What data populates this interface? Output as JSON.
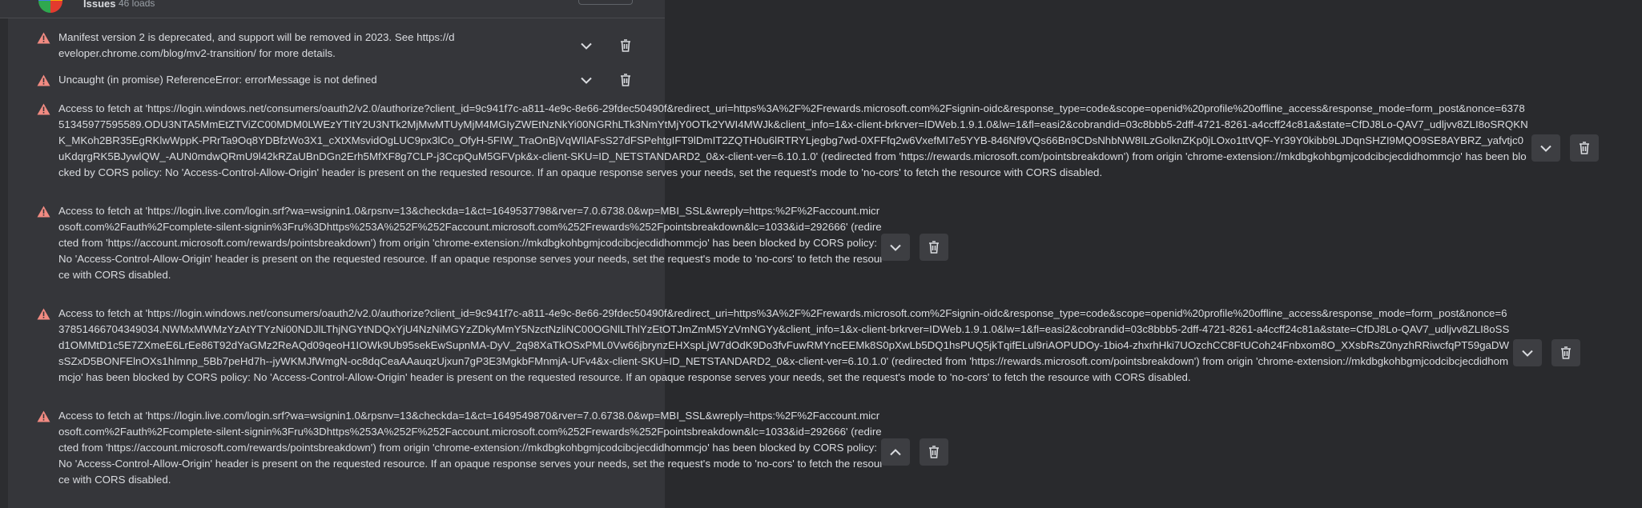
{
  "extension": {
    "name": "Issues",
    "sub": "46 loads"
  },
  "errors": [
    {
      "message": "Manifest version 2 is deprecated, and support will be removed in 2023. See https://developer.chrome.com/blog/mv2-transition/ for more details.",
      "expanded": false
    },
    {
      "message": "Uncaught (in promise) ReferenceError: errorMessage is not defined",
      "expanded": false
    },
    {
      "message": "Access to fetch at 'https://login.windows.net/consumers/oauth2/v2.0/authorize?client_id=9c941f7c-a811-4e9c-8e66-29fdec50490f&redirect_uri=https%3A%2F%2Frewards.microsoft.com%2Fsignin-oidc&response_type=code&scope=openid%20profile%20offline_access&response_mode=form_post&nonce=637851345977595589.ODU3NTA5MmEtZTViZC00MDM0LWEzYTItY2U3NTk2MjMwMTUyMjM4MGIyZWEtNzNkYi00NGRhLTk3NmYtMjY0OTk2YWI4MWJk&client_info=1&x-client-brkrver=IDWeb.1.9.1.0&lw=1&fl=easi2&cobrandid=03c8bbb5-2dff-4721-8261-a4ccff24c81a&state=CfDJ8Lo-QAV7_udljvv8ZLI8oSRQKNK_MKoh2BR35EgRKlwWppK-PRrTa9Oq8YDBfzWo3X1_cXtXMsvidOgLUC9px3lCo_OfyH-5FIW_TraOnBjVqWIlAFsS27dFSPehtgIFT9lDmIT2ZQTH0u6lRTRYLjegbg7wd-0XFFfq2w6VxefMI7e5YYB-846Nf9VQs66Bn9CDsNhbNW8ILzGolknZKp0jLOxo1ttVQF-Yr39Y0kibb9LJDqnSHZI9MQO9SE8AYBRZ_yafvtjc0uKdqrgRK5BJywlQW_-AUN0mdwQRmU9l42kRZaUBnDGn2Erh5MfXF8g7CLP-j3CcpQuM5GFVpk&x-client-SKU=ID_NETSTANDARD2_0&x-client-ver=6.10.1.0' (redirected from 'https://rewards.microsoft.com/pointsbreakdown') from origin 'chrome-extension://mkdbgkohbgmjcodcibcjecdidhommcjo' has been blocked by CORS policy: No 'Access-Control-Allow-Origin' header is present on the requested resource. If an opaque response serves your needs, set the request's mode to 'no-cors' to fetch the resource with CORS disabled.",
      "expanded": false
    },
    {
      "message": "Access to fetch at 'https://login.live.com/login.srf?wa=wsignin1.0&rpsnv=13&checkda=1&ct=1649537798&rver=7.0.6738.0&wp=MBI_SSL&wreply=https:%2F%2Faccount.microsoft.com%2Fauth%2Fcomplete-silent-signin%3Fru%3Dhttps%253A%252F%252Faccount.microsoft.com%252Frewards%252Fpointsbreakdown&lc=1033&id=292666' (redirected from 'https://account.microsoft.com/rewards/pointsbreakdown') from origin 'chrome-extension://mkdbgkohbgmjcodcibcjecdidhommcjo' has been blocked by CORS policy: No 'Access-Control-Allow-Origin' header is present on the requested resource. If an opaque response serves your needs, set the request's mode to 'no-cors' to fetch the resource with CORS disabled.",
      "expanded": false
    },
    {
      "message": "Access to fetch at 'https://login.windows.net/consumers/oauth2/v2.0/authorize?client_id=9c941f7c-a811-4e9c-8e66-29fdec50490f&redirect_uri=https%3A%2F%2Frewards.microsoft.com%2Fsignin-oidc&response_type=code&scope=openid%20profile%20offline_access&response_mode=form_post&nonce=637851466704349034.NWMxMWMzYzAtYTYzNi00NDJlLThjNGYtNDQxYjU4NzNiMGYzZDkyMmY5NzctNzliNC00OGNlLThlYzEtOTJmZmM5YzVmNGYy&client_info=1&x-client-brkrver=IDWeb.1.9.1.0&lw=1&fl=easi2&cobrandid=03c8bbb5-2dff-4721-8261-a4ccff24c81a&state=CfDJ8Lo-QAV7_udljvv8ZLI8oSSd1OMMtD1c5E7ZXmeE6LrEe86T92dYaGMz2ReAQd09qeoH1IOWk9Ub95sekEwSupnMA-DyV_2q98XaTkOSxPML0Vw66jbrynzEHXspLjW7dOdK9Do3fvFuwRMYncEEMk8S0pXwLb5DQ1hsPUQ5jkTqifELul9riAOPUDOy-1bio4-zhxrhHki7UOzchCC8FtUCoh24Fnbxom8O_XXsbRsZ0nyzhRRiwcfqPT59gaDWsSZxD5BONFElnOXs1hImnp_5Bb7peHd7h--jyWKMJfWmgN-oc8dqCeaAAauqzUjxun7gP3E3MgkbFMnmjA-UFv4&x-client-SKU=ID_NETSTANDARD2_0&x-client-ver=6.10.1.0' (redirected from 'https://rewards.microsoft.com/pointsbreakdown') from origin 'chrome-extension://mkdbgkohbgmjcodcibcjecdidhommcjo' has been blocked by CORS policy: No 'Access-Control-Allow-Origin' header is present on the requested resource. If an opaque response serves your needs, set the request's mode to 'no-cors' to fetch the resource with CORS disabled.",
      "expanded": false
    },
    {
      "message": "Access to fetch at 'https://login.live.com/login.srf?wa=wsignin1.0&rpsnv=13&checkda=1&ct=1649549870&rver=7.0.6738.0&wp=MBI_SSL&wreply=https:%2F%2Faccount.microsoft.com%2Fauth%2Fcomplete-silent-signin%3Fru%3Dhttps%253A%252F%252Faccount.microsoft.com%252Frewards%252Fpointsbreakdown&lc=1033&id=292666' (redirected from 'https://account.microsoft.com/rewards/pointsbreakdown') from origin 'chrome-extension://mkdbgkohbgmjcodcibcjecdidhommcjo' has been blocked by CORS policy: No 'Access-Control-Allow-Origin' header is present on the requested resource. If an opaque response serves your needs, set the request's mode to 'no-cors' to fetch the resource with CORS disabled.",
      "expanded": true
    }
  ],
  "colors": {
    "warning": "#f28b82",
    "icon": "#9aa0a6",
    "panel": "#35363a",
    "background": "#292a2d"
  },
  "icons": {
    "warning": "warning-triangle-icon",
    "expand": "chevron-down-icon",
    "collapse": "chevron-up-icon",
    "delete": "trash-icon"
  }
}
